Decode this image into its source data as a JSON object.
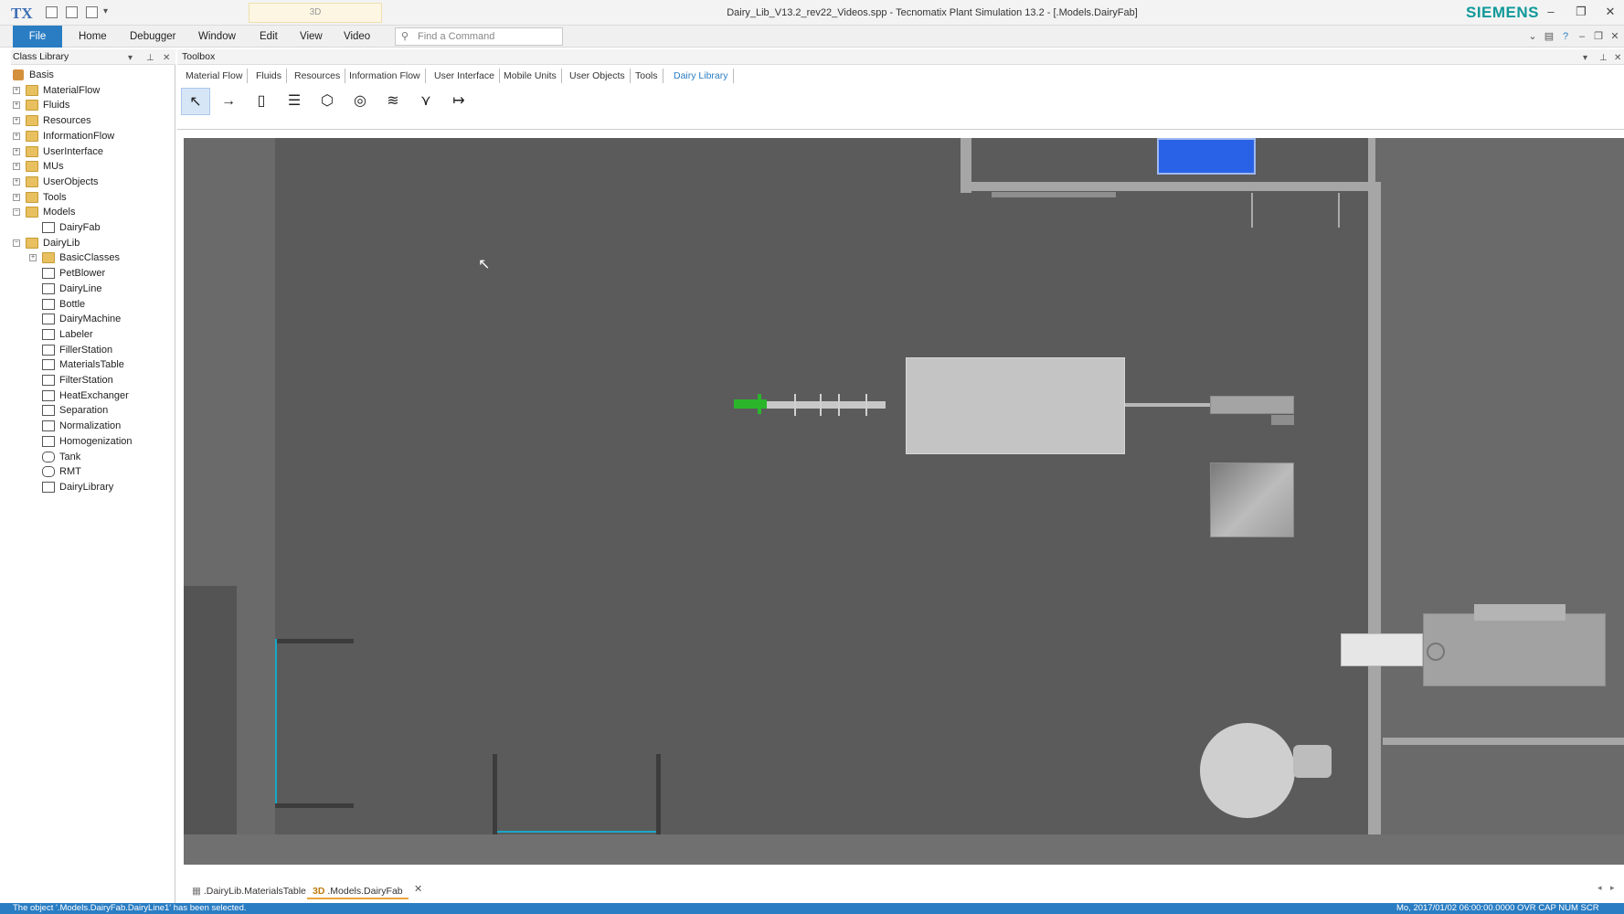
{
  "titlebar": {
    "logo": "TX",
    "context_tab": "3D",
    "title": "Dairy_Lib_V13.2_rev22_Videos.spp - Tecnomatix Plant Simulation 13.2 - [.Models.DairyFab]",
    "brand": "SIEMENS"
  },
  "menubar": {
    "items": [
      "File",
      "Home",
      "Debugger",
      "Window",
      "Edit",
      "View",
      "Video"
    ],
    "search_placeholder": "Find a Command"
  },
  "class_library": {
    "title": "Class Library",
    "tree": [
      {
        "label": "Basis",
        "icon": "root-icon"
      },
      {
        "label": "MaterialFlow",
        "icon": "folder-icon"
      },
      {
        "label": "Fluids",
        "icon": "folder-icon"
      },
      {
        "label": "Resources",
        "icon": "folder-icon"
      },
      {
        "label": "InformationFlow",
        "icon": "folder-icon"
      },
      {
        "label": "UserInterface",
        "icon": "folder-icon"
      },
      {
        "label": "MUs",
        "icon": "folder-icon"
      },
      {
        "label": "UserObjects",
        "icon": "folder-icon"
      },
      {
        "label": "Tools",
        "icon": "folder-icon"
      },
      {
        "label": "Models",
        "icon": "folder-icon"
      },
      {
        "label": "DairyFab",
        "icon": "frame-icon"
      },
      {
        "label": "DairyLib",
        "icon": "folder-icon"
      },
      {
        "label": "BasicClasses",
        "icon": "folder-icon"
      },
      {
        "label": "PetBlower",
        "icon": "source-icon"
      },
      {
        "label": "DairyLine",
        "icon": "line-icon"
      },
      {
        "label": "Bottle",
        "icon": "entity-icon"
      },
      {
        "label": "DairyMachine",
        "icon": "machine-icon"
      },
      {
        "label": "Labeler",
        "icon": "station-icon"
      },
      {
        "label": "FillerStation",
        "icon": "frame-icon"
      },
      {
        "label": "MaterialsTable",
        "icon": "table-icon"
      },
      {
        "label": "FilterStation",
        "icon": "frame-icon"
      },
      {
        "label": "HeatExchanger",
        "icon": "frame-icon"
      },
      {
        "label": "Separation",
        "icon": "frame-icon"
      },
      {
        "label": "Normalization",
        "icon": "frame-icon"
      },
      {
        "label": "Homogenization",
        "icon": "frame-icon"
      },
      {
        "label": "Tank",
        "icon": "tank-icon"
      },
      {
        "label": "RMT",
        "icon": "tank-icon"
      },
      {
        "label": "DairyLibrary",
        "icon": "library-icon"
      }
    ]
  },
  "toolbox": {
    "title": "Toolbox",
    "tabs": [
      "Material Flow",
      "Fluids",
      "Resources",
      "Information Flow",
      "User Interface",
      "Mobile Units",
      "User Objects",
      "Tools",
      "Dairy Library"
    ],
    "active_tab": "Dairy Library",
    "tools": [
      {
        "name": "pointer-icon",
        "glyph": "↖"
      },
      {
        "name": "connector-icon",
        "glyph": "→"
      },
      {
        "name": "bottle-tool-icon",
        "glyph": "▯"
      },
      {
        "name": "dairyline-tool-icon",
        "glyph": "☰"
      },
      {
        "name": "tank-tool-icon",
        "glyph": "⬡"
      },
      {
        "name": "machine-tool-icon",
        "glyph": "◎"
      },
      {
        "name": "frame-tool-icon",
        "glyph": "≋"
      },
      {
        "name": "filler-tool-icon",
        "glyph": "⋎"
      },
      {
        "name": "source-tool-icon",
        "glyph": "↦"
      }
    ]
  },
  "document_tabs": [
    {
      "label": ".DairyLib.MaterialsTable",
      "icon": "table-icon",
      "active": false
    },
    {
      "label": ".Models.DairyFab",
      "prefix": "3D",
      "active": true
    }
  ],
  "statusbar": {
    "message": "The object '.Models.DairyFab.DairyLine1' has been selected.",
    "right": "Mo, 2017/01/02 06:00:00.0000  OVR  CAP  NUM  SCR"
  },
  "colors": {
    "accent": "#2a7dc3",
    "brand": "#119999",
    "viewport_bg": "#5b5b5b",
    "selected_highlight": "#2bb52b",
    "screen_blue": "#2962e6"
  }
}
